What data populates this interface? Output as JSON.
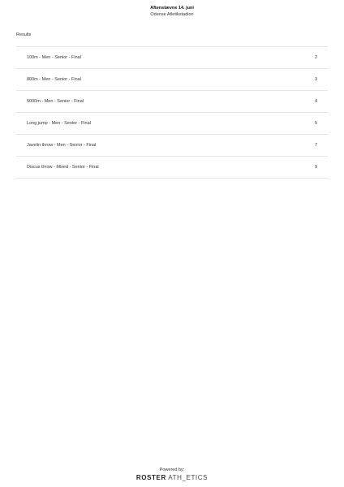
{
  "header": {
    "title": "Aftenstævne 14. juni",
    "venue": "Odense Atletikstadion"
  },
  "section_title": "Results",
  "results": [
    {
      "label": "100m - Men - Senior - Final",
      "page": "2"
    },
    {
      "label": "800m - Men - Senior - Final",
      "page": "3"
    },
    {
      "label": "5000m - Men - Senior - Final",
      "page": "4"
    },
    {
      "label": "Long jump - Men - Senior - Final",
      "page": "5"
    },
    {
      "label": "Javelin throw - Men - Senior - Final",
      "page": "7"
    },
    {
      "label": "Discus throw - Mixed - Senior - Final",
      "page": "9"
    }
  ],
  "footer": {
    "powered_by": "Powered by:",
    "brand_bold": "ROSTER",
    "brand_light": "ATH_ETICS"
  }
}
